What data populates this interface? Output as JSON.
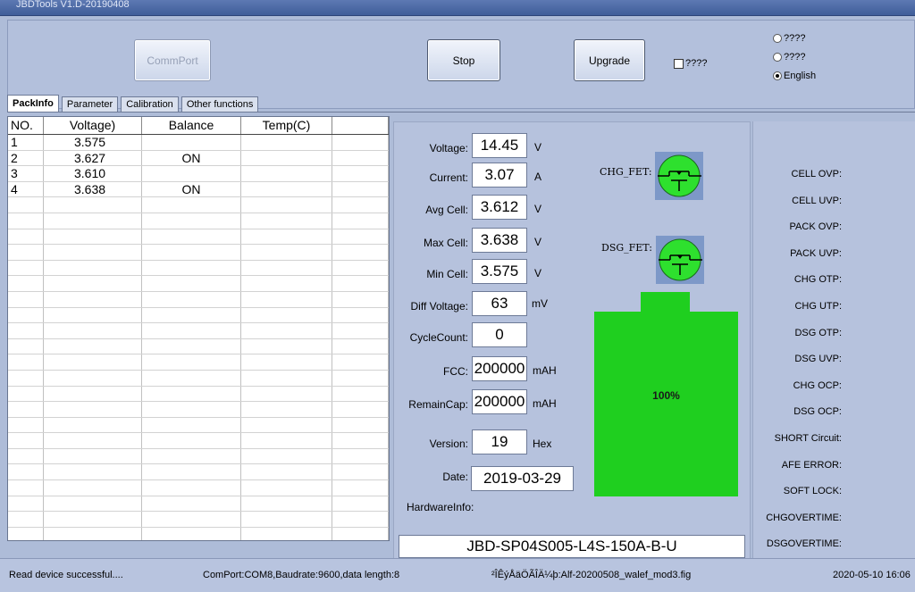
{
  "app": {
    "title": "JBDTools V1.D-20190408"
  },
  "toolbar": {
    "comm_port_label": "CommPort",
    "stop_label": "Stop",
    "upgrade_label": "Upgrade",
    "checkbox_label": "????"
  },
  "language": {
    "options": [
      {
        "label": "????",
        "checked": false
      },
      {
        "label": "????",
        "checked": false
      },
      {
        "label": "English",
        "checked": true
      }
    ]
  },
  "tabs": [
    "PackInfo",
    "Parameter",
    "Calibration",
    "Other functions"
  ],
  "cell_table": {
    "headers": [
      "NO.",
      "Voltage)",
      "Balance",
      "Temp(C)",
      ""
    ],
    "rows": [
      [
        "1",
        "3.575",
        "",
        "",
        ""
      ],
      [
        "2",
        "3.627",
        "ON",
        "",
        ""
      ],
      [
        "3",
        "3.610",
        "",
        "",
        ""
      ],
      [
        "4",
        "3.638",
        "ON",
        "",
        ""
      ]
    ]
  },
  "pack": {
    "voltage": {
      "label": "Voltage:",
      "value": "14.45",
      "unit": "V"
    },
    "current": {
      "label": "Current:",
      "value": "3.07",
      "unit": "A"
    },
    "avg_cell": {
      "label": "Avg Cell:",
      "value": "3.612",
      "unit": "V"
    },
    "max_cell": {
      "label": "Max Cell:",
      "value": "3.638",
      "unit": "V"
    },
    "min_cell": {
      "label": "Min Cell:",
      "value": "3.575",
      "unit": "V"
    },
    "diff_voltage": {
      "label": "Diff Voltage:",
      "value": "63",
      "unit": "mV"
    },
    "cycle_count": {
      "label": "CycleCount:",
      "value": "0",
      "unit": ""
    },
    "fcc": {
      "label": "FCC:",
      "value": "200000",
      "unit": "mAH"
    },
    "remain_cap": {
      "label": "RemainCap:",
      "value": "200000",
      "unit": "mAH"
    },
    "version": {
      "label": "Version:",
      "value": "19",
      "unit": "Hex"
    },
    "date": {
      "label": "Date:",
      "value": "2019-03-29"
    },
    "hardware_label": "HardwareInfo:",
    "hardware_value": "JBD-SP04S005-L4S-150A-B-U"
  },
  "fets": {
    "chg_label": "CHG_FET:",
    "dsg_label": "DSG_FET:",
    "on_color": "#2ee02e"
  },
  "battery": {
    "percent": 1.0,
    "percent_label": "100%",
    "fill_color": "#1fcf1f"
  },
  "protections": [
    "CELL OVP:",
    "CELL UVP:",
    "PACK OVP:",
    "PACK UVP:",
    "CHG OTP:",
    "CHG UTP:",
    "DSG OTP:",
    "DSG UVP:",
    "CHG OCP:",
    "DSG OCP:",
    "SHORT Circuit:",
    "AFE ERROR:",
    "SOFT LOCK:",
    "CHGOVERTIME:",
    "DSGOVERTIME:"
  ],
  "status": {
    "message": "Read device successful....",
    "port_info": "ComPort:COM8,Baudrate:9600,data length:8",
    "config_file": "²ÎÊýÅäÖÃÎÄ¼þ:Alf-20200508_walef_mod3.fig",
    "datetime": "2020-05-10 16:06"
  }
}
